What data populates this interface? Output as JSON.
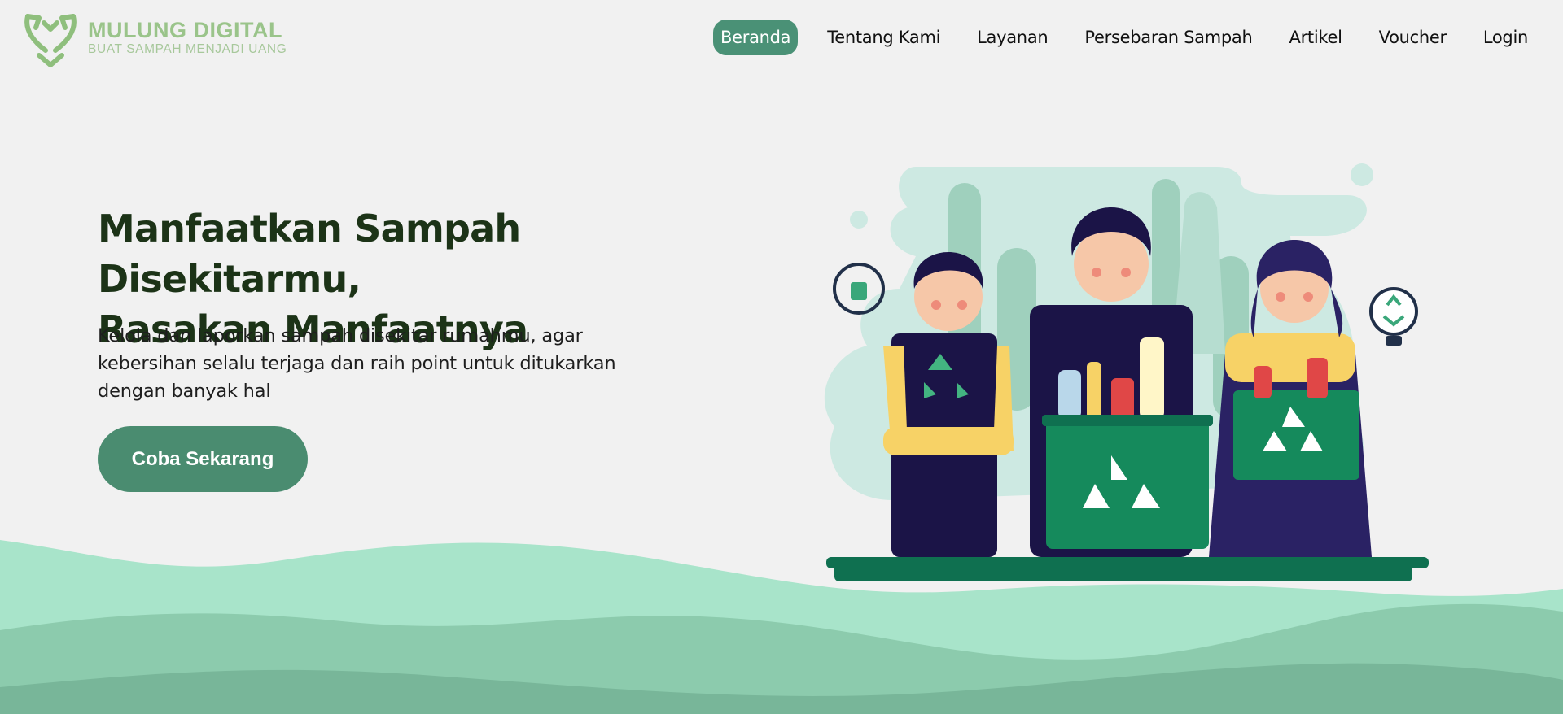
{
  "header": {
    "logo": {
      "name": "MULUNG DIGITAL",
      "tagline": "BUAT SAMPAH MENJADI UANG",
      "icon": "recycle-heart-icon"
    },
    "nav": [
      {
        "label": "Beranda",
        "active": true
      },
      {
        "label": "Tentang Kami",
        "active": false
      },
      {
        "label": "Layanan",
        "active": false
      },
      {
        "label": "Persebaran Sampah",
        "active": false
      },
      {
        "label": "Artikel",
        "active": false
      },
      {
        "label": "Voucher",
        "active": false
      },
      {
        "label": "Login",
        "active": false
      }
    ]
  },
  "hero": {
    "title_line1": "Manfaatkan Sampah Disekitarmu,",
    "title_line2": "Rasakan Manfaatnya",
    "desc_line1": "Kelola dan laporkan sampah disekitar rumahmu, agar",
    "desc_line2": "kebersihan selalu terjaga dan raih point untuk ditukarkan",
    "desc_line3": "dengan banyak hal",
    "cta_label": "Coba Sekarang"
  },
  "colors": {
    "background": "#f1f1f1",
    "accent": "#4a9176",
    "logo": "#9ac48a",
    "title": "#1c3317",
    "wave_light": "#a8e4ca",
    "wave_mid": "#8ccbad",
    "wave_dark": "#78b699"
  }
}
